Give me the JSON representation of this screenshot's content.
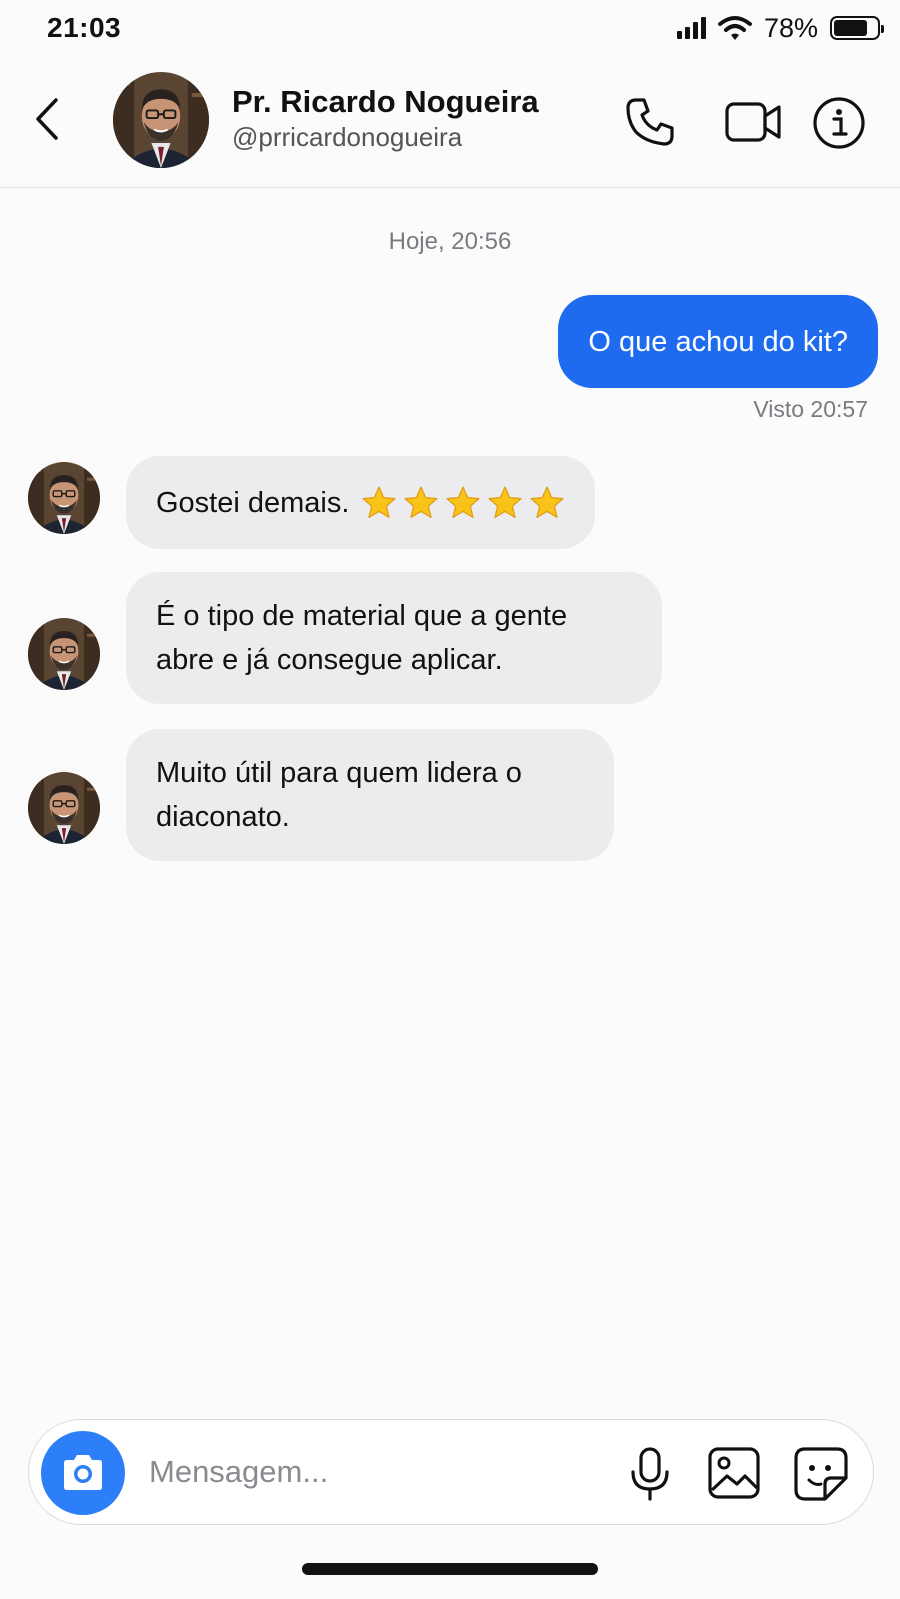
{
  "status_bar": {
    "time": "21:03",
    "battery_percent_label": "78%",
    "battery_level": 0.78,
    "signal_bars": 4,
    "icons": [
      "signal-icon",
      "wifi-icon",
      "battery-icon"
    ]
  },
  "header": {
    "contact_name": "Pr. Ricardo Nogueira",
    "contact_handle": "@prricardonogueira",
    "icons": [
      "back-icon",
      "phone-icon",
      "video-call-icon",
      "info-icon"
    ]
  },
  "chat": {
    "timestamp": "Hoje, 20:56",
    "outgoing": {
      "text": "O que achou do kit?",
      "seen": "Visto 20:57"
    },
    "incoming": [
      {
        "text": "Gostei demais.",
        "stars": 5
      },
      {
        "text": "É o tipo de material que a gente abre e já consegue aplicar."
      },
      {
        "text": "Muito útil para quem lidera o diaconato."
      }
    ]
  },
  "composer": {
    "placeholder": "Mensagem...",
    "icons": [
      "camera-icon",
      "microphone-icon",
      "gallery-icon",
      "sticker-icon"
    ]
  },
  "colors": {
    "outgoing_bubble": "#1f6bf0",
    "incoming_bubble": "#ececef",
    "camera_button": "#2d7ff9",
    "muted_text": "#7a7a80"
  }
}
